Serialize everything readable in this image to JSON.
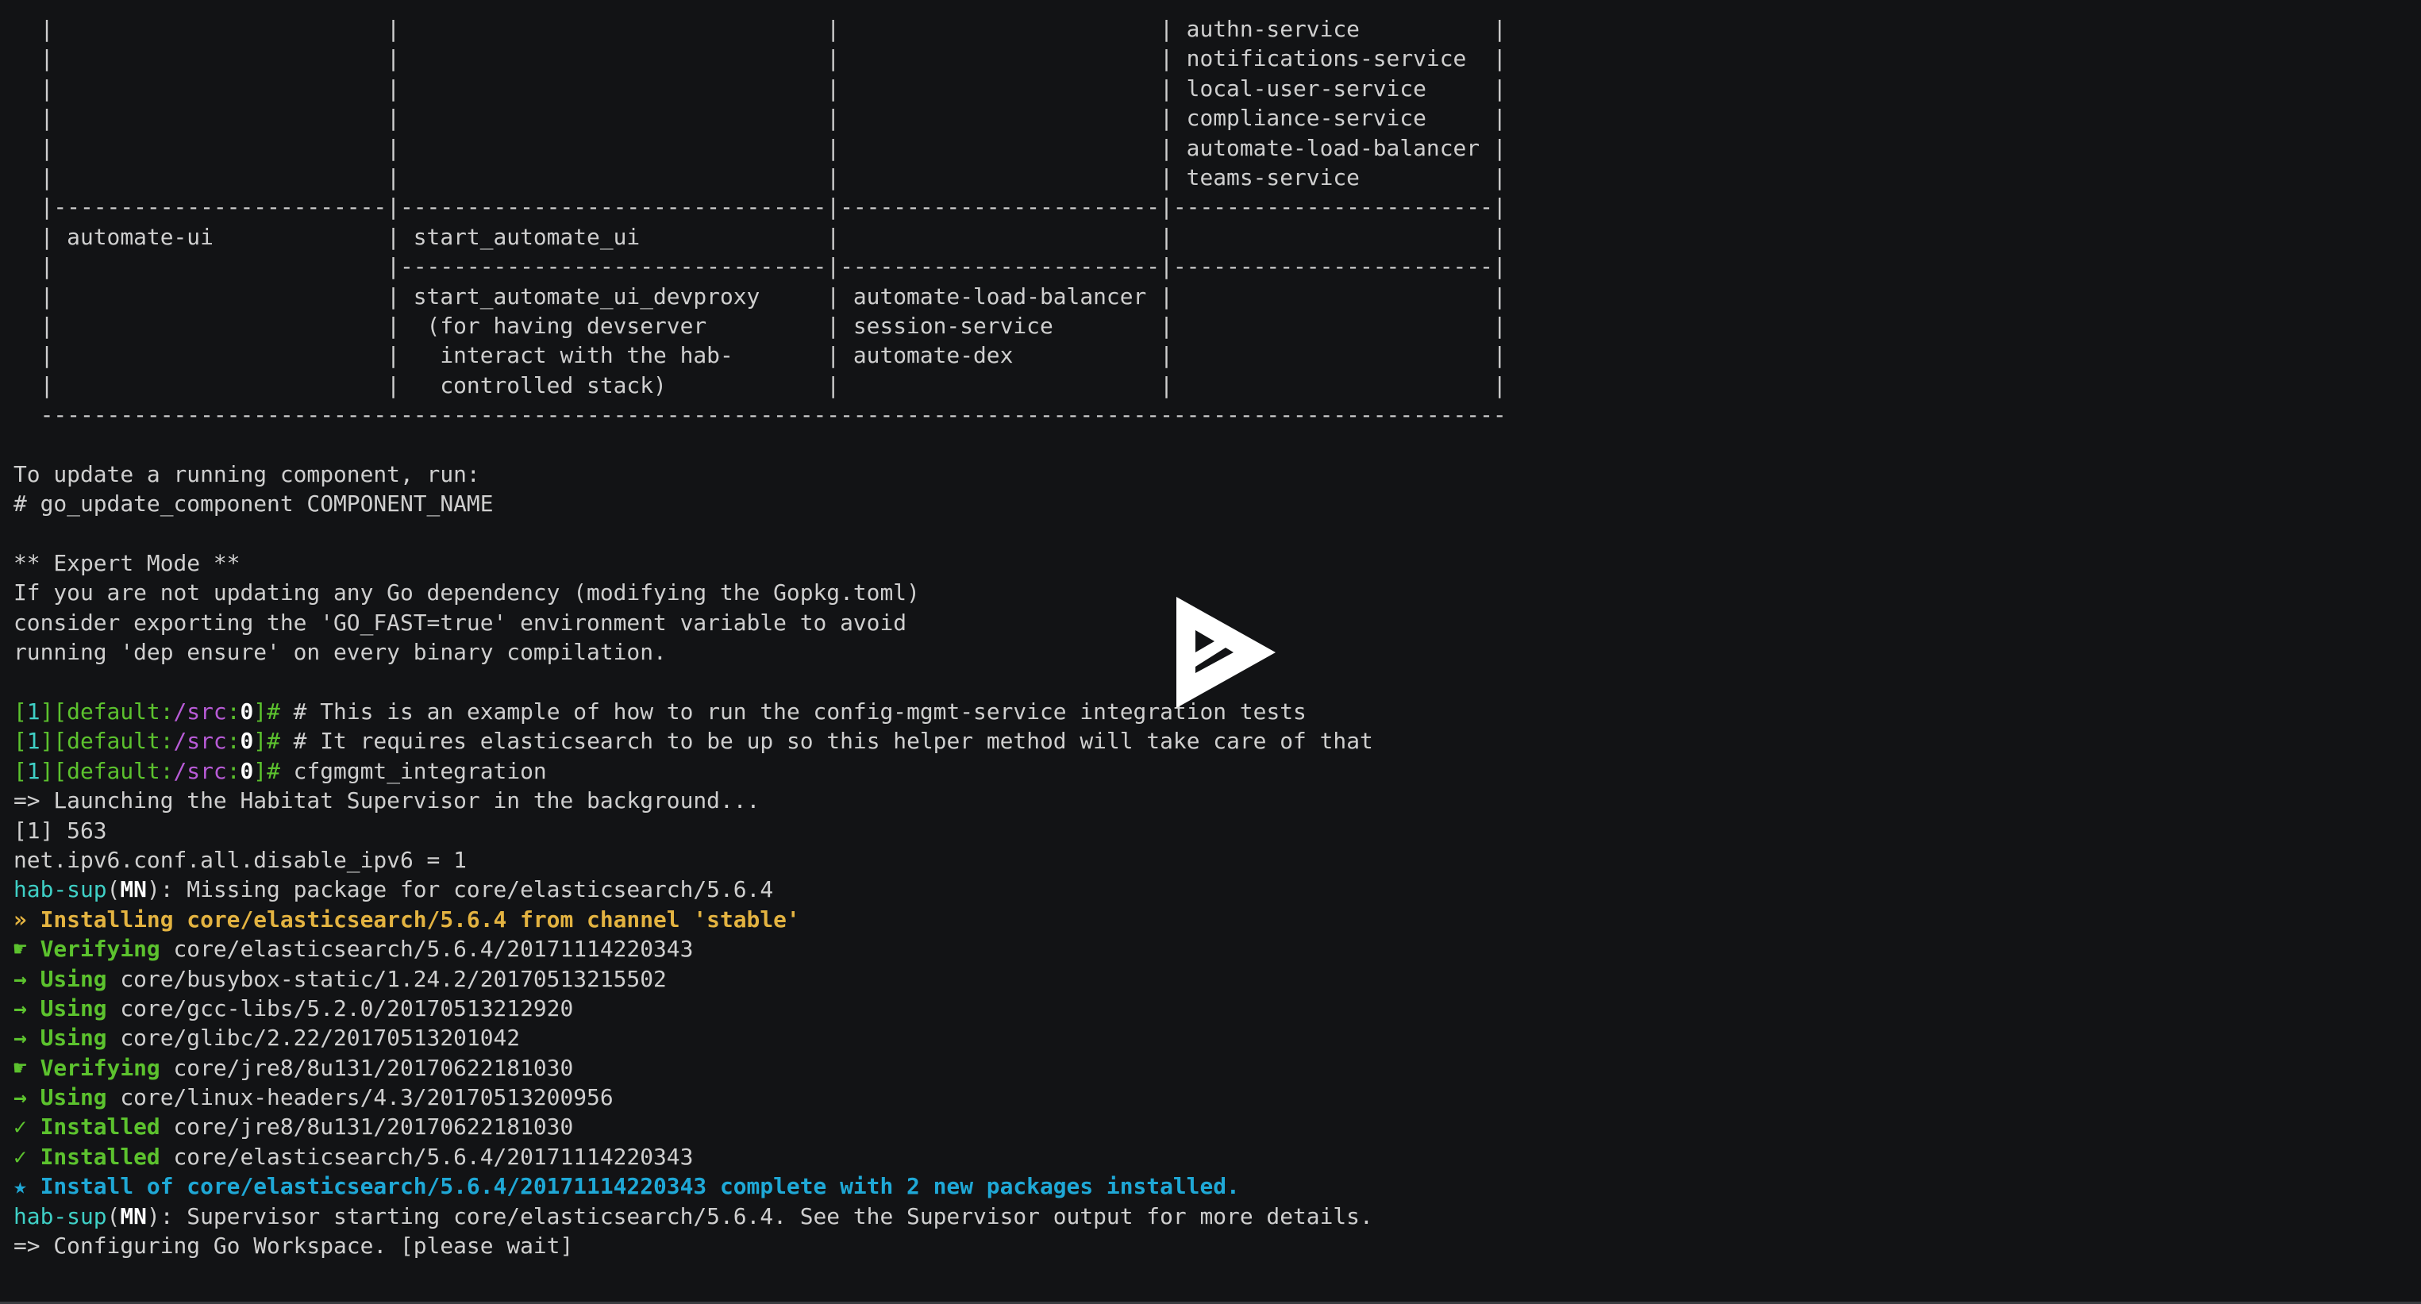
{
  "colors": {
    "background": "#121315",
    "text": "#cfcfcf",
    "green": "#5cc22e",
    "yellow": "#e3b341",
    "cyan": "#3fd0c6",
    "blue": "#1fa8d6",
    "purple": "#b85bd6"
  },
  "player": {
    "icon": "asciinema-play-icon"
  },
  "lines": [
    [
      {
        "t": "  |                         |                                |                        | authn-service          |",
        "c": ""
      }
    ],
    [
      {
        "t": "  |                         |                                |                        | notifications-service  |",
        "c": ""
      }
    ],
    [
      {
        "t": "  |                         |                                |                        | local-user-service     |",
        "c": ""
      }
    ],
    [
      {
        "t": "  |                         |                                |                        | compliance-service     |",
        "c": ""
      }
    ],
    [
      {
        "t": "  |                         |                                |                        | automate-load-balancer |",
        "c": ""
      }
    ],
    [
      {
        "t": "  |                         |                                |                        | teams-service          |",
        "c": ""
      }
    ],
    [
      {
        "t": "  |-------------------------|--------------------------------|------------------------|------------------------|",
        "c": ""
      }
    ],
    [
      {
        "t": "  | automate-ui             | start_automate_ui              |                        |                        |",
        "c": ""
      }
    ],
    [
      {
        "t": "  |                         |--------------------------------|------------------------|------------------------|",
        "c": ""
      }
    ],
    [
      {
        "t": "  |                         | start_automate_ui_devproxy     | automate-load-balancer |                        |",
        "c": ""
      }
    ],
    [
      {
        "t": "  |                         |  (for having devserver         | session-service        |                        |",
        "c": ""
      }
    ],
    [
      {
        "t": "  |                         |   interact with the hab-       | automate-dex           |                        |",
        "c": ""
      }
    ],
    [
      {
        "t": "  |                         |   controlled stack)            |                        |                        |",
        "c": ""
      }
    ],
    [
      {
        "t": "  --------------------------------------------------------------------------------------------------------------",
        "c": ""
      }
    ],
    [
      {
        "t": "",
        "c": ""
      }
    ],
    [
      {
        "t": "To update a running component, run:",
        "c": ""
      }
    ],
    [
      {
        "t": "# go_update_component COMPONENT_NAME",
        "c": ""
      }
    ],
    [
      {
        "t": "",
        "c": ""
      }
    ],
    [
      {
        "t": "** Expert Mode **",
        "c": ""
      }
    ],
    [
      {
        "t": "If you are not updating any Go dependency (modifying the Gopkg.toml)",
        "c": ""
      }
    ],
    [
      {
        "t": "consider exporting the 'GO_FAST=true' environment variable to avoid",
        "c": ""
      }
    ],
    [
      {
        "t": "running 'dep ensure' on every binary compilation.",
        "c": ""
      }
    ],
    [
      {
        "t": "",
        "c": ""
      }
    ],
    [
      {
        "t": "[",
        "c": "g"
      },
      {
        "t": "1",
        "c": "c"
      },
      {
        "t": "][default:",
        "c": "g"
      },
      {
        "t": "/src",
        "c": "p"
      },
      {
        "t": ":",
        "c": "g"
      },
      {
        "t": "0",
        "c": "w"
      },
      {
        "t": "]#",
        "c": "g"
      },
      {
        "t": " # This is an example of how to run the config-mgmt-service integration tests",
        "c": ""
      }
    ],
    [
      {
        "t": "[",
        "c": "g"
      },
      {
        "t": "1",
        "c": "c"
      },
      {
        "t": "][default:",
        "c": "g"
      },
      {
        "t": "/src",
        "c": "p"
      },
      {
        "t": ":",
        "c": "g"
      },
      {
        "t": "0",
        "c": "w"
      },
      {
        "t": "]#",
        "c": "g"
      },
      {
        "t": " # It requires elasticsearch to be up so this helper method will take care of that",
        "c": ""
      }
    ],
    [
      {
        "t": "[",
        "c": "g"
      },
      {
        "t": "1",
        "c": "c"
      },
      {
        "t": "][default:",
        "c": "g"
      },
      {
        "t": "/src",
        "c": "p"
      },
      {
        "t": ":",
        "c": "g"
      },
      {
        "t": "0",
        "c": "w"
      },
      {
        "t": "]#",
        "c": "g"
      },
      {
        "t": " cfgmgmt_integration",
        "c": ""
      }
    ],
    [
      {
        "t": "=> Launching the Habitat Supervisor in the background...",
        "c": ""
      }
    ],
    [
      {
        "t": "[1] 563",
        "c": ""
      }
    ],
    [
      {
        "t": "net.ipv6.conf.all.disable_ipv6 = 1",
        "c": ""
      }
    ],
    [
      {
        "t": "hab-sup",
        "c": "c"
      },
      {
        "t": "(",
        "c": ""
      },
      {
        "t": "MN",
        "c": "w"
      },
      {
        "t": "): Missing package for core/elasticsearch/5.6.4",
        "c": ""
      }
    ],
    [
      {
        "t": "» Installing core/elasticsearch/5.6.4 from channel 'stable'",
        "c": "y"
      }
    ],
    [
      {
        "t": "☛ Verifying",
        "c": "gb"
      },
      {
        "t": " core/elasticsearch/5.6.4/20171114220343",
        "c": ""
      }
    ],
    [
      {
        "t": "→ Using",
        "c": "gb"
      },
      {
        "t": " core/busybox-static/1.24.2/20170513215502",
        "c": ""
      }
    ],
    [
      {
        "t": "→ Using",
        "c": "gb"
      },
      {
        "t": " core/gcc-libs/5.2.0/20170513212920",
        "c": ""
      }
    ],
    [
      {
        "t": "→ Using",
        "c": "gb"
      },
      {
        "t": " core/glibc/2.22/20170513201042",
        "c": ""
      }
    ],
    [
      {
        "t": "☛ Verifying",
        "c": "gb"
      },
      {
        "t": " core/jre8/8u131/20170622181030",
        "c": ""
      }
    ],
    [
      {
        "t": "→ Using",
        "c": "gb"
      },
      {
        "t": " core/linux-headers/4.3/20170513200956",
        "c": ""
      }
    ],
    [
      {
        "t": "✓ Installed",
        "c": "gb"
      },
      {
        "t": " core/jre8/8u131/20170622181030",
        "c": ""
      }
    ],
    [
      {
        "t": "✓ Installed",
        "c": "gb"
      },
      {
        "t": " core/elasticsearch/5.6.4/20171114220343",
        "c": ""
      }
    ],
    [
      {
        "t": "★ Install of core/elasticsearch/5.6.4/20171114220343 complete with 2 new packages installed.",
        "c": "b"
      }
    ],
    [
      {
        "t": "hab-sup",
        "c": "c"
      },
      {
        "t": "(",
        "c": ""
      },
      {
        "t": "MN",
        "c": "w"
      },
      {
        "t": "): Supervisor starting core/elasticsearch/5.6.4. See the Supervisor output for more details.",
        "c": ""
      }
    ],
    [
      {
        "t": "=> Configuring Go Workspace. [please wait]",
        "c": ""
      }
    ]
  ]
}
